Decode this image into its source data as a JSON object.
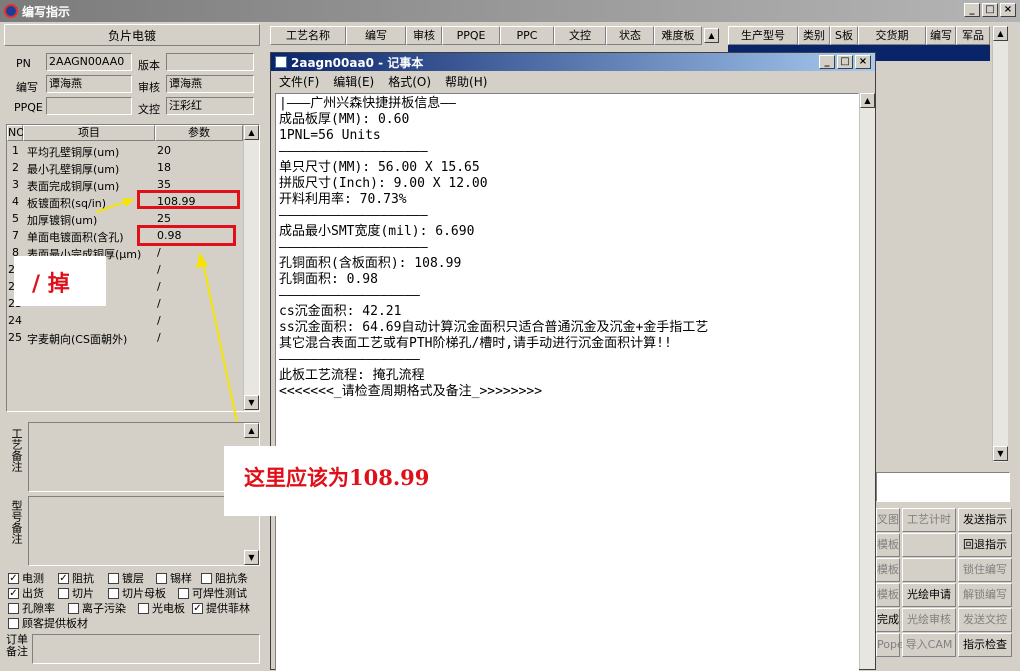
{
  "window": {
    "title": "编写指示",
    "min": "_",
    "max": "□",
    "close": "×"
  },
  "left": {
    "header": "负片电镀",
    "pn_label": "PN",
    "pn_value": "2AAGN00AA0",
    "version_label": "版本",
    "version_value": "",
    "writer_label": "编写",
    "writer_value": "谭海燕",
    "reviewer_label": "审核",
    "reviewer_value": "谭海燕",
    "ppqe_label": "PPQE",
    "ppqe_value": "",
    "control_label": "文控",
    "control_value": "汪彩红",
    "grid": {
      "col_no": "NO",
      "col_item": "项目",
      "col_param": "参数",
      "rows": [
        {
          "no": "1",
          "item": "平均孔壁铜厚(um)",
          "param": "20"
        },
        {
          "no": "2",
          "item": "最小孔壁铜厚(um)",
          "param": "18"
        },
        {
          "no": "3",
          "item": "表面完成铜厚(um)",
          "param": "35"
        },
        {
          "no": "4",
          "item": "板镀面积(sq/in)",
          "param": "108.99"
        },
        {
          "no": "5",
          "item": "加厚镀铜(um)",
          "param": "25"
        },
        {
          "no": "7",
          "item": "单面电镀面积(含孔)",
          "param": "0.98"
        },
        {
          "no": "8",
          "item": "表面最小完成铜厚(μm)",
          "param": "/"
        },
        {
          "no": "21",
          "item": "",
          "param": "/"
        },
        {
          "no": "22",
          "item": "",
          "param": "/"
        },
        {
          "no": "23",
          "item": "",
          "param": "/"
        },
        {
          "no": "24",
          "item": "",
          "param": "/"
        },
        {
          "no": "25",
          "item": "字麦朝向(CS面朝外)",
          "param": "/"
        }
      ]
    },
    "memo1_label": "工艺备注",
    "memo2_label": "型号备注",
    "checkboxes": [
      {
        "label": "电测",
        "checked": "✓"
      },
      {
        "label": "阻抗",
        "checked": "✓"
      },
      {
        "label": "镀层",
        "checked": ""
      },
      {
        "label": "锡样",
        "checked": ""
      },
      {
        "label": "阻抗条",
        "checked": ""
      },
      {
        "label": "出货",
        "checked": "✓"
      },
      {
        "label": "切片",
        "checked": ""
      },
      {
        "label": "切片母板",
        "checked": ""
      },
      {
        "label": "可焊性测试",
        "checked": ""
      },
      {
        "label": "孔隙率",
        "checked": ""
      },
      {
        "label": "离子污染",
        "checked": ""
      },
      {
        "label": "光电板",
        "checked": ""
      },
      {
        "label": "提供菲林",
        "checked": "✓"
      },
      {
        "label": "顾客提供板材",
        "checked": ""
      }
    ],
    "order_label": "订单备注"
  },
  "annotations": {
    "remove": "/ 掉",
    "should_be": "这里应该为108.99"
  },
  "right": {
    "headers1": [
      "工艺名称",
      "编写",
      "审核",
      "PPQE",
      "PPC",
      "文控",
      "状态",
      "难度板"
    ],
    "headers2": [
      "生产型号",
      "类别",
      "S板",
      "交货期",
      "编写",
      "军品"
    ],
    "buttons": [
      [
        "叉图",
        "工艺计时",
        "发送指示"
      ],
      [
        "模板",
        "",
        "回退指示"
      ],
      [
        "模板",
        "",
        "锁住编写"
      ],
      [
        "模板",
        "光绘申请",
        "解锁编写"
      ],
      [
        "完成",
        "光绘审核",
        "发送文控"
      ],
      [
        "Pope",
        "导入CAM",
        "指示检查"
      ]
    ]
  },
  "notepad": {
    "title": "2aagn00aa0 - 记事本",
    "menu": [
      "文件(F)",
      "编辑(E)",
      "格式(O)",
      "帮助(H)"
    ],
    "lines": [
      "|———广州兴森快捷拼板信息——",
      "成品板厚(MM): 0.60",
      "1PNL=56 Units",
      "———————————————————",
      "单只尺寸(MM): 56.00 X 15.65",
      "拼版尺寸(Inch): 9.00 X 12.00",
      "开料利用率: 70.73%",
      "———————————————————",
      "成品最小SMT宽度(mil): 6.690",
      "———————————————————",
      "孔铜面积(含板面积): 108.99",
      "孔铜面积: 0.98",
      "——————————————————",
      "cs沉金面积: 42.21",
      "ss沉金面积: 64.69自动计算沉金面积只适合普通沉金及沉金+金手指工艺",
      "其它混合表面工艺或有PTH阶梯孔/槽时,请手动进行沉金面积计算!!",
      "——————————————————",
      "此板工艺流程: 掩孔流程",
      "<<<<<<<_请检查周期格式及备注_>>>>>>>>"
    ]
  }
}
